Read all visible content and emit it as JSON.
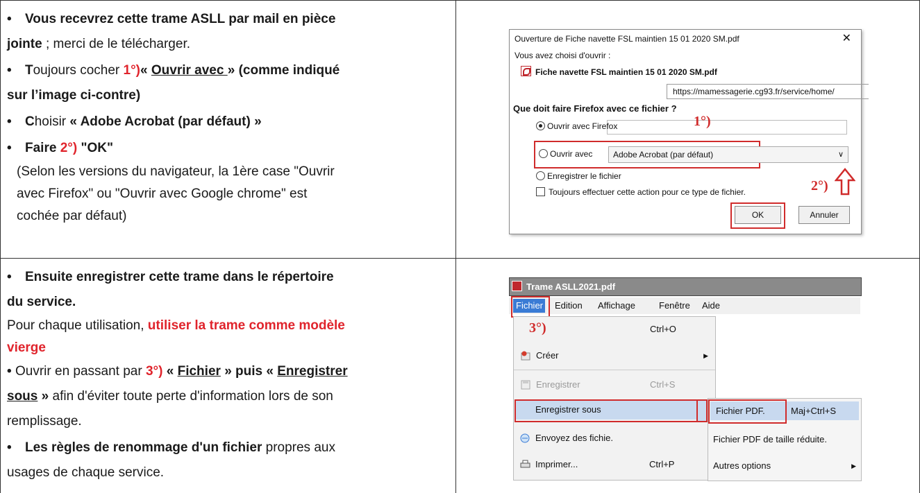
{
  "row1": {
    "b1_a": "Vous recevrez cette trame ASLL par mail en pièce",
    "b1_b_bold": "jointe",
    "b1_b_rest": " ; merci de le télécharger.",
    "b2_T": "T",
    "b2_rest": "oujours cocher ",
    "b2_num": "1°)",
    "b2_q1": "« ",
    "b2_link": "Ouvrir avec ",
    "b2_q2": " » (comme indiqué",
    "b2_line2": "sur l’image ci-contre)",
    "b3_C": "C",
    "b3_rest": "hoisir ",
    "b3_bold": "« Adobe Acrobat (par défaut) »",
    "b4_a": "Faire ",
    "b4_num": "2°)",
    "b4_ok": " \"OK\"",
    "note_1": "(Selon les versions du navigateur, la 1ère case \"Ouvrir",
    "note_2": "avec Firefox\" ou \"Ouvrir avec Google chrome\" est",
    "note_3": "cochée par défaut)"
  },
  "row2": {
    "b1_a": "Ensuite enregistrer cette trame dans le répertoire",
    "b1_b": "du service.",
    "p_a": "Pour chaque utilisation, ",
    "p_red_a": "utiliser la trame comme modèle",
    "p_red_b": "vierge",
    "o_a": "Ouvrir en passant par ",
    "o_num": "3°)",
    "o_q1": " « ",
    "o_fichier": "Fichier",
    "o_q2": " » puis « ",
    "o_enr": "Enregistrer",
    "o_sous": "sous",
    "o_q3": " »",
    "o_rest": " afin d'éviter toute perte d'information lors de son",
    "o_line3": "remplissage.",
    "r_bold": "Les règles de renommage d'un fichier",
    "r_rest": " propres aux",
    "r_line2": "usages de chaque service."
  },
  "dialog": {
    "title": "Ouverture de Fiche navette FSL maintien 15 01 2020 SM.pdf",
    "close": "✕",
    "chose": "Vous avez choisi d'ouvrir :",
    "filename": "Fiche navette FSL maintien 15 01 2020 SM.pdf",
    "url": "https://mamessagerie.cg93.fr/service/home/",
    "question": "Que doit faire Firefox avec ce fichier ?",
    "opt_firefox": "Ouvrir avec Firefox",
    "opt_avec": "Ouvrir avec",
    "combo_value": "Adobe Acrobat (par défaut)",
    "opt_save": "Enregistrer le fichier",
    "always": "Toujours effectuer cette action pour ce type de fichier.",
    "ok": "OK",
    "cancel": "Annuler",
    "label1": "1°)",
    "label2": "2°)"
  },
  "window": {
    "title": "Trame ASLL2021.pdf",
    "menu": [
      "Fichier",
      "Edition",
      "Affichage",
      "Fenêtre",
      "Aide"
    ],
    "label3": "3°)",
    "open_shortcut": "Ctrl+O",
    "create": "Créer",
    "save": "Enregistrer",
    "save_shortcut": "Ctrl+S",
    "save_as": "Enregistrer sous",
    "send": "Envoyez des fichie.",
    "print": "Imprimer...",
    "print_shortcut": "Ctrl+P",
    "sub_pdf": "Fichier PDF.",
    "sub_pdf_shortcut": "Maj+Ctrl+S",
    "sub_reduced": "Fichier PDF de taille réduite.",
    "sub_other": "Autres options"
  },
  "colors": {
    "accent_red": "#e0242c",
    "menu_blue": "#3a7bd5",
    "highlight": "#c8d9ef"
  }
}
